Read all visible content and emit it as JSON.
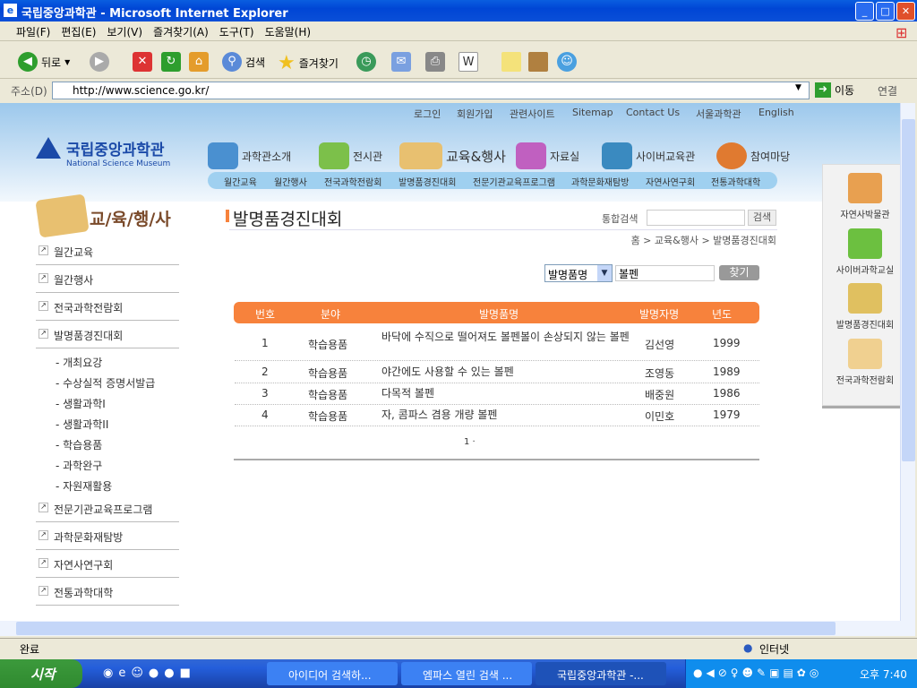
{
  "window": {
    "title": "국립중앙과학관 - Microsoft Internet Explorer",
    "min": "_",
    "max": "□",
    "close": "✕"
  },
  "menubar": [
    "파일(F)",
    "편집(E)",
    "보기(V)",
    "즐겨찾기(A)",
    "도구(T)",
    "도움말(H)"
  ],
  "toolbar": {
    "back": "뒤로",
    "search": "검색",
    "favorites": "즐겨찾기"
  },
  "address": {
    "label": "주소(D)",
    "url": "http://www.science.go.kr/",
    "go": "이동",
    "links": "연결"
  },
  "site": {
    "logo": {
      "name": "국립중앙과학관",
      "sub": "National Science Museum"
    },
    "top_links": [
      "로그인",
      "회원가입",
      "관련사이트",
      "Sitemap",
      "Contact Us",
      "서울과학관",
      "English"
    ],
    "main_menu": [
      "과학관소개",
      "전시관",
      "교육&행사",
      "자료실",
      "사이버교육관",
      "참여마당"
    ],
    "sub_menu": [
      "월간교육",
      "월간행사",
      "전국과학전람회",
      "발명품경진대회",
      "전문기관교육프로그램",
      "과학문화재탐방",
      "자연사연구회",
      "전통과학대학"
    ],
    "section_title": "교/육/행/사",
    "left_menu": [
      "월간교육",
      "월간행사",
      "전국과학전람회",
      "발명품경진대회"
    ],
    "left_sub": [
      "- 개최요강",
      "- 수상실적 증명서발급",
      "- 생활과학I",
      "- 생활과학II",
      "- 학습용품",
      "- 과학완구",
      "- 자원재활용"
    ],
    "left_menu2": [
      "전문기관교육프로그램",
      "과학문화재탐방",
      "자연사연구회",
      "전통과학대학"
    ],
    "right_banner": [
      "자연사박물관",
      "사이버과학교실",
      "발명품경진대회",
      "전국과학전람회"
    ]
  },
  "content": {
    "title": "발명품경진대회",
    "search_label": "통합검색",
    "search_value": "",
    "search_button": "검색",
    "breadcrumb": "홈 > 교육&행사 > 발명품경진대회",
    "filter": {
      "select": "발명품명",
      "query": "볼펜",
      "button": "찾기"
    },
    "table": {
      "headers": [
        "번호",
        "분야",
        "발명품명",
        "발명자명",
        "년도"
      ],
      "rows": [
        {
          "no": "1",
          "field": "학습용품",
          "name": "바닥에 수직으로 떨어져도 볼펜볼이 손상되지 않는 볼펜",
          "inventor": "김선영",
          "year": "1999"
        },
        {
          "no": "2",
          "field": "학습용품",
          "name": "야간에도 사용할 수 있는 볼펜",
          "inventor": "조영동",
          "year": "1989"
        },
        {
          "no": "3",
          "field": "학습용품",
          "name": "다목적 볼펜",
          "inventor": "배중원",
          "year": "1986"
        },
        {
          "no": "4",
          "field": "학습용품",
          "name": "자, 콤파스 겸용 개량 볼펜",
          "inventor": "이민호",
          "year": "1979"
        }
      ]
    },
    "pager": "1 ·",
    "accent": "#f7823c"
  },
  "status": {
    "text": "완료",
    "zone": "인터넷"
  },
  "taskbar": {
    "start": "시작",
    "tasks": [
      "아이디어 검색하...",
      "엠파스 열린 검색 ...",
      "국립중앙과학관 -..."
    ],
    "clock": "오후 7:40"
  }
}
